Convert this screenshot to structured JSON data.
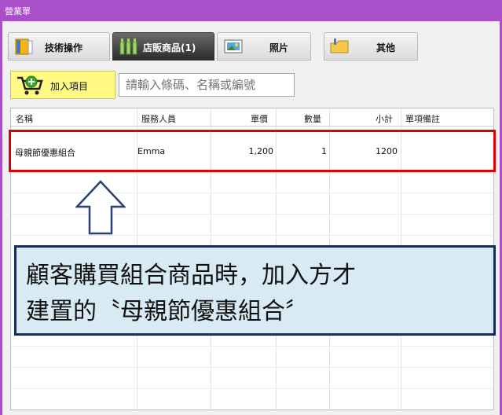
{
  "window": {
    "title": "營業單"
  },
  "tabs": [
    {
      "label": "技術操作",
      "icon": "book-icon"
    },
    {
      "label": "店販商品(1)",
      "icon": "bottles-icon",
      "active": true
    },
    {
      "label": "照片",
      "icon": "photo-icon"
    },
    {
      "label": "其他",
      "icon": "folder-icon"
    }
  ],
  "toolbar": {
    "add_label": "加入項目",
    "search_placeholder": "請輸入條碼、名稱或編號"
  },
  "table": {
    "columns": [
      "名稱",
      "服務人員",
      "單價",
      "數量",
      "小計",
      "單項備註"
    ],
    "rows": [
      {
        "name": "母親節優惠組合",
        "staff": "Emma",
        "price": "1,200",
        "qty": "1",
        "subtotal": "1200",
        "note": ""
      }
    ]
  },
  "annotation": {
    "line1": "顧客購買組合商品時，加入方才",
    "line2": "建置的〝母親節優惠組合〞"
  },
  "colors": {
    "titlebar": "#a84fc9",
    "highlight": "#e00000",
    "callout_bg": "#d8eaf3",
    "callout_border": "#1b2c56"
  }
}
